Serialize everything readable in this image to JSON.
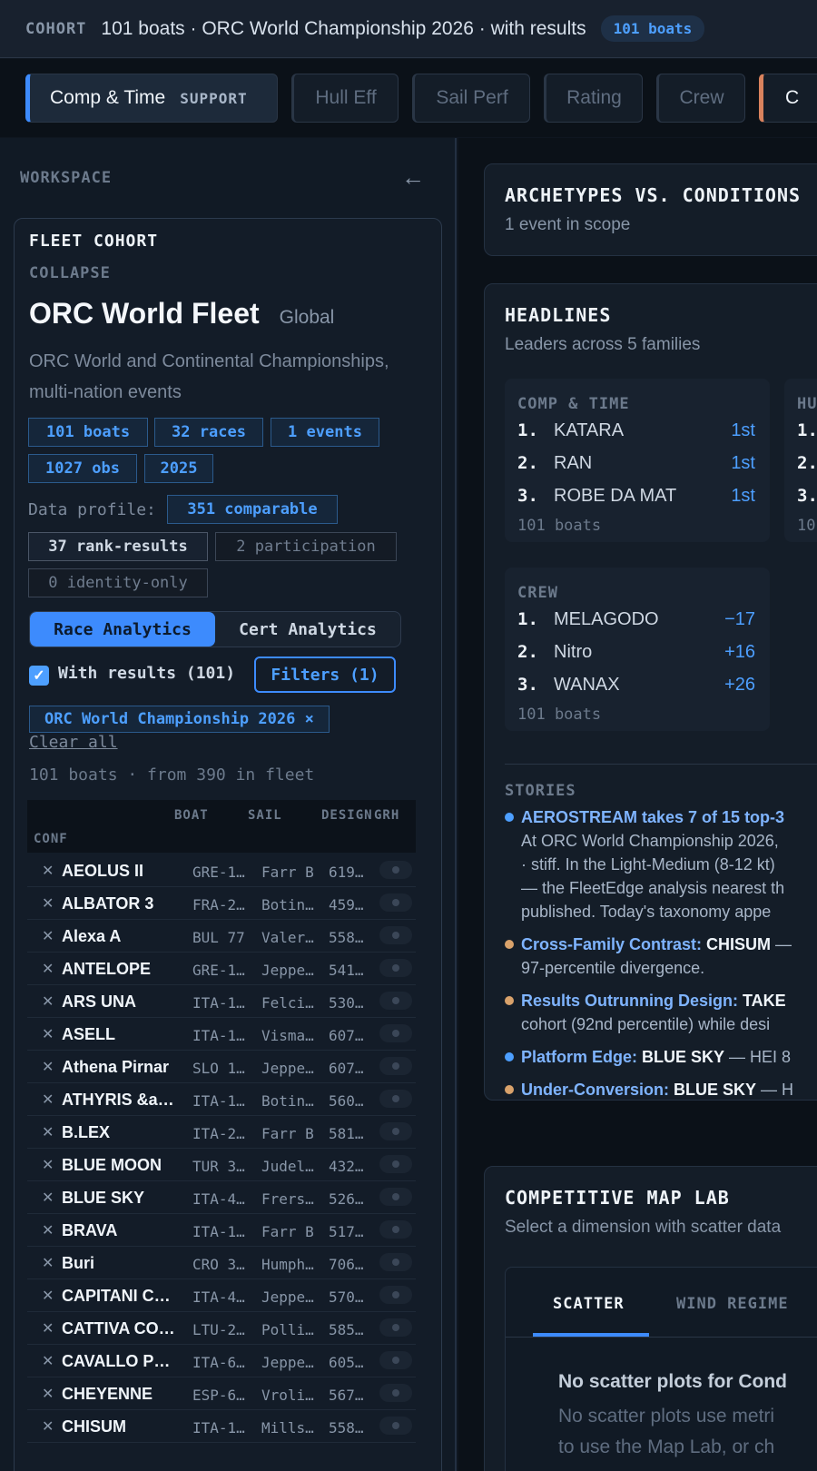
{
  "topbar": {
    "cohort_label": "COHORT",
    "title": "101 boats · ORC World Championship 2026 · with results",
    "badge": "101 boats"
  },
  "tabs": [
    {
      "label": "Comp & Time",
      "tag": "SUPPORT",
      "active": true
    },
    {
      "label": "Hull Eff"
    },
    {
      "label": "Sail Perf"
    },
    {
      "label": "Rating"
    },
    {
      "label": "Crew"
    },
    {
      "label": "C"
    }
  ],
  "sidebar": {
    "workspace_label": "WORKSPACE",
    "collapse_arrow": "←",
    "fleet_cohort_label": "FLEET COHORT",
    "collapse_label": "COLLAPSE",
    "fleet_name": "ORC World Fleet",
    "fleet_scope": "Global",
    "fleet_description": "ORC World and Continental Championships, multi-nation events",
    "stats": [
      "101 boats",
      "32 races",
      "1 events",
      "1027 obs",
      "2025"
    ],
    "data_profile_label": "Data profile:",
    "profile_chips": [
      "351 comparable",
      "37 rank-results",
      "2 participation",
      "0 identity-only"
    ],
    "analytics_toggle": [
      "Race Analytics",
      "Cert Analytics"
    ],
    "with_results_label": "With results (101)",
    "with_results_checked": true,
    "filters_button": "Filters (1)",
    "active_filter": "ORC World Championship 2026 ×",
    "clear_all": "Clear all",
    "boat_count": "101 boats · from 390 in fleet",
    "table_headers": {
      "boat": "BOAT",
      "sail": "SAIL",
      "design": "DESIGN",
      "grh": "GRH",
      "conf": "CONF"
    },
    "boats": [
      {
        "name": "AEOLUS II",
        "sail": "GRE-1…",
        "design": "Farr B",
        "grh": "619…"
      },
      {
        "name": "ALBATOR 3",
        "sail": "FRA-2…",
        "design": "Botin…",
        "grh": "459…"
      },
      {
        "name": "Alexa A",
        "sail": "BUL 77",
        "design": "Valer…",
        "grh": "558…"
      },
      {
        "name": "ANTELOPE",
        "sail": "GRE-1…",
        "design": "Jeppe…",
        "grh": "541…"
      },
      {
        "name": "ARS UNA",
        "sail": "ITA-1…",
        "design": "Felci…",
        "grh": "530…"
      },
      {
        "name": "ASELL",
        "sail": "ITA-1…",
        "design": "Visma…",
        "grh": "607…"
      },
      {
        "name": "Athena Pirnar",
        "sail": "SLO 1…",
        "design": "Jeppe…",
        "grh": "607…"
      },
      {
        "name": "ATHYRIS &a…",
        "sail": "ITA-1…",
        "design": "Botin…",
        "grh": "560…"
      },
      {
        "name": "B.LEX",
        "sail": "ITA-2…",
        "design": "Farr B",
        "grh": "581…"
      },
      {
        "name": "BLUE MOON",
        "sail": "TUR 3…",
        "design": "Judel…",
        "grh": "432…"
      },
      {
        "name": "BLUE SKY",
        "sail": "ITA-4…",
        "design": "Frers…",
        "grh": "526…"
      },
      {
        "name": "BRAVA",
        "sail": "ITA-1…",
        "design": "Farr B",
        "grh": "517…"
      },
      {
        "name": "Buri",
        "sail": "CRO 3…",
        "design": "Humph…",
        "grh": "706…"
      },
      {
        "name": "CAPITANI C…",
        "sail": "ITA-4…",
        "design": "Jeppe…",
        "grh": "570…"
      },
      {
        "name": "CATTIVA CO…",
        "sail": "LTU-2…",
        "design": "Polli…",
        "grh": "585…"
      },
      {
        "name": "CAVALLO P…",
        "sail": "ITA-6…",
        "design": "Jeppe…",
        "grh": "605…"
      },
      {
        "name": "CHEYENNE",
        "sail": "ESP-6…",
        "design": "Vroli…",
        "grh": "567…"
      },
      {
        "name": "CHISUM",
        "sail": "ITA-1…",
        "design": "Mills…",
        "grh": "558…"
      }
    ]
  },
  "main": {
    "archetypes": {
      "title": "ARCHETYPES VS. CONDITIONS",
      "subtitle": "1 event in scope"
    },
    "headlines": {
      "title": "HEADLINES",
      "subtitle": "Leaders across 5 families",
      "boards": [
        {
          "title": "COMP & TIME",
          "items": [
            {
              "rank": "1.",
              "name": "KATARA",
              "value": "1st"
            },
            {
              "rank": "2.",
              "name": "RAN",
              "value": "1st"
            },
            {
              "rank": "3.",
              "name": "ROBE DA MAT",
              "value": "1st"
            }
          ],
          "footer": "101 boats"
        },
        {
          "title": "HU",
          "items": [
            {
              "rank": "1.",
              "name": "",
              "value": ""
            },
            {
              "rank": "2.",
              "name": "",
              "value": ""
            },
            {
              "rank": "3.",
              "name": "",
              "value": ""
            }
          ],
          "footer": "10"
        },
        {
          "title": "CREW",
          "items": [
            {
              "rank": "1.",
              "name": "MELAGODO",
              "value": "−17"
            },
            {
              "rank": "2.",
              "name": "Nitro",
              "value": "+16"
            },
            {
              "rank": "3.",
              "name": "WANAX",
              "value": "+26"
            }
          ],
          "footer": "101 boats"
        }
      ],
      "stories_label": "STORIES",
      "stories": [
        {
          "dot": "#4d9fff",
          "lines": [
            {
              "parts": [
                {
                  "t": "AEROSTREAM takes 7 of 15 top-3",
                  "c": "title"
                }
              ]
            },
            {
              "parts": [
                {
                  "t": "At ORC World Championship 2026,",
                  "c": "plain"
                }
              ]
            },
            {
              "parts": [
                {
                  "t": "· stiff. In the Light-Medium (8-12 kt)",
                  "c": "plain"
                }
              ]
            },
            {
              "parts": [
                {
                  "t": "— the FleetEdge analysis nearest th",
                  "c": "plain"
                }
              ]
            },
            {
              "parts": [
                {
                  "t": "published. Today's taxonomy appe",
                  "c": "plain"
                }
              ]
            }
          ]
        },
        {
          "dot": "#d9a26b",
          "lines": [
            {
              "parts": [
                {
                  "t": "Cross-Family Contrast: ",
                  "c": "title"
                },
                {
                  "t": "CHISUM",
                  "c": "hl"
                },
                {
                  "t": " —",
                  "c": "plain"
                }
              ]
            },
            {
              "parts": [
                {
                  "t": "97-percentile divergence.",
                  "c": "plain"
                }
              ]
            }
          ]
        },
        {
          "dot": "#d9a26b",
          "lines": [
            {
              "parts": [
                {
                  "t": "Results Outrunning Design: ",
                  "c": "title"
                },
                {
                  "t": "TAKE",
                  "c": "hl"
                }
              ]
            },
            {
              "parts": [
                {
                  "t": "cohort (92nd percentile) while desi",
                  "c": "plain"
                }
              ]
            }
          ]
        },
        {
          "dot": "#4d9fff",
          "lines": [
            {
              "parts": [
                {
                  "t": "Platform Edge: ",
                  "c": "title"
                },
                {
                  "t": "BLUE SKY",
                  "c": "hl"
                },
                {
                  "t": " — HEI 8",
                  "c": "plain"
                }
              ]
            }
          ]
        },
        {
          "dot": "#d9a26b",
          "lines": [
            {
              "parts": [
                {
                  "t": "Under-Conversion: ",
                  "c": "title"
                },
                {
                  "t": "BLUE SKY",
                  "c": "hl"
                },
                {
                  "t": " — H",
                  "c": "plain"
                }
              ]
            }
          ]
        }
      ]
    },
    "map_lab": {
      "title": "COMPETITIVE MAP LAB",
      "subtitle": "Select a dimension with scatter data",
      "tabs": [
        "SCATTER",
        "WIND REGIME"
      ],
      "empty_title": "No scatter plots for Cond",
      "empty_body_line1": "No scatter plots use metri",
      "empty_body_line2": "to use the Map Lab, or ch"
    }
  }
}
